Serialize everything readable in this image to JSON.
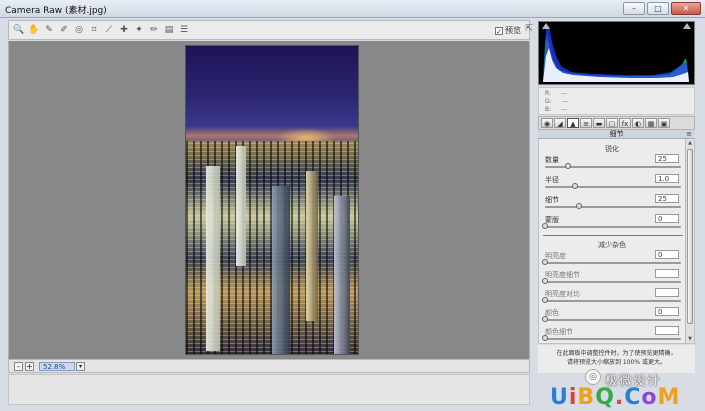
{
  "window": {
    "title": "Camera Raw (素材.jpg)",
    "buttons": {
      "minimize": "–",
      "maximize": "□",
      "close": "✕"
    }
  },
  "toolbar": {
    "tools": [
      {
        "name": "zoom-tool-icon",
        "glyph": "🔍"
      },
      {
        "name": "hand-tool-icon",
        "glyph": "✋"
      },
      {
        "name": "white-balance-tool-icon",
        "glyph": "✎"
      },
      {
        "name": "color-sampler-tool-icon",
        "glyph": "✐"
      },
      {
        "name": "targeted-adjustment-tool-icon",
        "glyph": "◎"
      },
      {
        "name": "crop-tool-icon",
        "glyph": "⌗"
      },
      {
        "name": "straighten-tool-icon",
        "glyph": "⟋"
      },
      {
        "name": "spot-removal-tool-icon",
        "glyph": "✚"
      },
      {
        "name": "red-eye-tool-icon",
        "glyph": "✦"
      },
      {
        "name": "adjustment-brush-tool-icon",
        "glyph": "✏"
      },
      {
        "name": "graduated-filter-tool-icon",
        "glyph": "▤"
      },
      {
        "name": "preferences-tool-icon",
        "glyph": "☰"
      }
    ],
    "preview_label": "预览",
    "preview_checked": "✓",
    "fullscreen_glyph": "⇱"
  },
  "canvas": {
    "zoom_value": "52.8%",
    "zoom_minus": "-",
    "zoom_plus": "+",
    "zoom_dropdown": "▾"
  },
  "histogram": {
    "background": "#000000",
    "colors": {
      "red": "#ff2020",
      "green": "#20ff20",
      "blue": "#2040ff",
      "white": "#ffffff"
    }
  },
  "readout": {
    "r_label": "R:",
    "g_label": "G:",
    "b_label": "B:",
    "r_value": "---",
    "g_value": "---",
    "b_value": "---"
  },
  "panel_tabs": [
    {
      "name": "tab-basic-icon",
      "glyph": "◉"
    },
    {
      "name": "tab-tone-curve-icon",
      "glyph": "◢"
    },
    {
      "name": "tab-detail-icon",
      "glyph": "▲"
    },
    {
      "name": "tab-hsl-icon",
      "glyph": "≡"
    },
    {
      "name": "tab-split-toning-icon",
      "glyph": "▬"
    },
    {
      "name": "tab-lens-corrections-icon",
      "glyph": "▢"
    },
    {
      "name": "tab-effects-icon",
      "glyph": "fx"
    },
    {
      "name": "tab-camera-calibration-icon",
      "glyph": "◐"
    },
    {
      "name": "tab-presets-icon",
      "glyph": "▦"
    },
    {
      "name": "tab-snapshots-icon",
      "glyph": "▣"
    }
  ],
  "panel": {
    "title": "细节",
    "menu_glyph": "≡",
    "sharpening": {
      "title": "锐化",
      "sliders": [
        {
          "label": "数量",
          "value": "25",
          "fraction": 0.17
        },
        {
          "label": "半径",
          "value": "1.0",
          "fraction": 0.22
        },
        {
          "label": "细节",
          "value": "25",
          "fraction": 0.25
        },
        {
          "label": "蒙版",
          "value": "0",
          "fraction": 0.0
        }
      ]
    },
    "noise_reduction": {
      "title": "减少杂色",
      "sliders": [
        {
          "label": "明亮度",
          "value": "0",
          "fraction": 0.0
        },
        {
          "label": "明亮度细节",
          "value": "",
          "fraction": 0.0
        },
        {
          "label": "明亮度对比",
          "value": "",
          "fraction": 0.0
        },
        {
          "label": "颜色",
          "value": "0",
          "fraction": 0.0
        },
        {
          "label": "颜色细节",
          "value": "",
          "fraction": 0.0
        }
      ]
    }
  },
  "hint": {
    "line1": "在此面板中调整控件时，为了使预览更精确，",
    "line2": "请将预览大小缩放到 100% 或更大。"
  },
  "watermark": {
    "logo_glyph": "◎",
    "text": "极微设计"
  },
  "brand": {
    "text": "UiBQ.CoM"
  }
}
